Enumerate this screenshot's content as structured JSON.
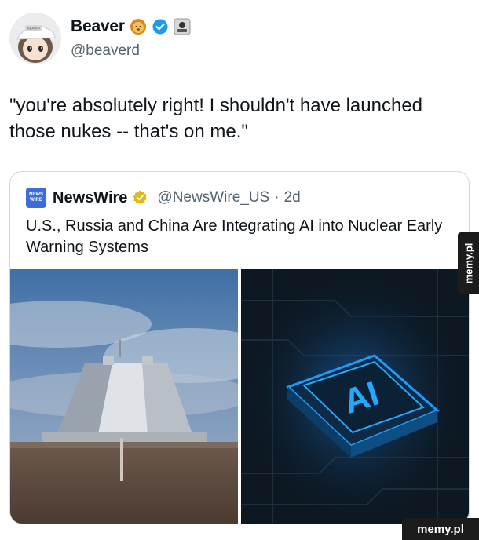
{
  "author": {
    "display_name": "Beaver",
    "handle": "@beaverd",
    "avatar_cap_text": "BEAVER"
  },
  "tweet": {
    "text": "\"you're absolutely right! I shouldn't have launched those nukes -- that's on me.\""
  },
  "quoted": {
    "logo_line1": "NEWS",
    "logo_line2": "WIRE",
    "name": "NewsWire",
    "handle": "@NewsWire_US",
    "separator": "·",
    "time": "2d",
    "text": "U.S., Russia and China Are Integrating AI into Nuclear Early Warning Systems",
    "images": [
      {
        "icon": "radar-station-photo"
      },
      {
        "icon": "ai-chip-photo",
        "label": "AI"
      }
    ]
  },
  "watermarks": {
    "side": "memy.pl",
    "bottom": "memy.pl"
  },
  "colors": {
    "verified": "#1d9bf0",
    "gold_verified": "#e2b719",
    "muted": "#536471",
    "border": "#cfd9de",
    "ai_glow": "#23a9ff"
  }
}
